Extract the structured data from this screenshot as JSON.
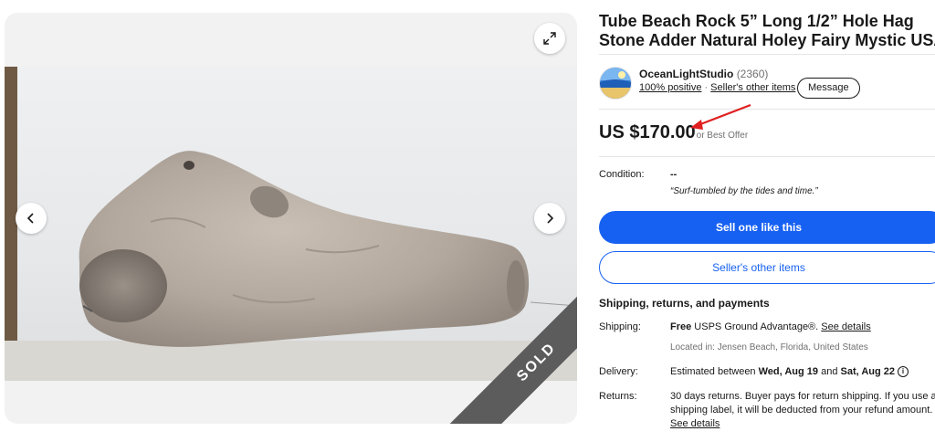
{
  "gallery": {
    "sold_label": "SOLD",
    "icons": {
      "expand": "expand-icon",
      "prev": "chevron-left-icon",
      "next": "chevron-right-icon"
    }
  },
  "listing": {
    "title": "Tube Beach Rock 5” Long 1/2” Hole Hag Stone Adder Natural Holey Fairy Mystic USA",
    "price": "US $170.00",
    "offer_text": "or Best Offer",
    "annotation_color": "#e02020"
  },
  "seller": {
    "name": "OceanLightStudio",
    "feedback_count": "(2360)",
    "positive": "100% positive",
    "other_items": "Seller's other items",
    "message_label": "Message"
  },
  "condition": {
    "label": "Condition:",
    "value": "--",
    "quote": "“Surf-tumbled by the tides and time.”"
  },
  "actions": {
    "sell_one": "Sell one like this",
    "sellers_other": "Seller's other items"
  },
  "shipping": {
    "heading": "Shipping, returns, and payments",
    "shipping_label": "Shipping:",
    "shipping_free": "Free",
    "shipping_method": " USPS Ground Advantage®. ",
    "see_details": "See details",
    "located": "Located in: Jensen Beach, Florida, United States",
    "delivery_label": "Delivery:",
    "delivery_pre": "Estimated between ",
    "delivery_from": "Wed, Aug 19",
    "delivery_and": " and ",
    "delivery_to": "Sat, Aug 22",
    "returns_label": "Returns:",
    "returns_line1": "30 days returns. Buyer pays for return shipping. If you use an eBay",
    "returns_line2": "shipping label, it will be deducted from your refund amount.",
    "returns_details": "See details"
  },
  "colors": {
    "primary": "#1761f2",
    "sold_ribbon": "#5c5c5c"
  }
}
